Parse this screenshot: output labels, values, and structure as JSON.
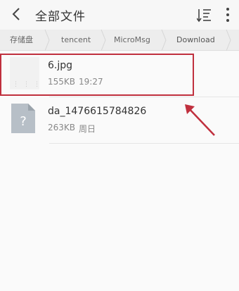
{
  "header": {
    "title": "全部文件"
  },
  "breadcrumb": [
    "存储盘",
    "tencent",
    "MicroMsg",
    "Download"
  ],
  "files": [
    {
      "name": "6.jpg",
      "size": "155KB",
      "time": "19:27"
    },
    {
      "name": "da_1476615784826",
      "size": "263KB",
      "time": "周日"
    }
  ],
  "colors": {
    "highlight": "#c0303e",
    "background": "#f7f7f7"
  },
  "icons": {
    "back": "chevron-left-icon",
    "sort": "sort-icon",
    "more": "more-vertical-icon",
    "unknown_file": "unknown-file-icon"
  }
}
